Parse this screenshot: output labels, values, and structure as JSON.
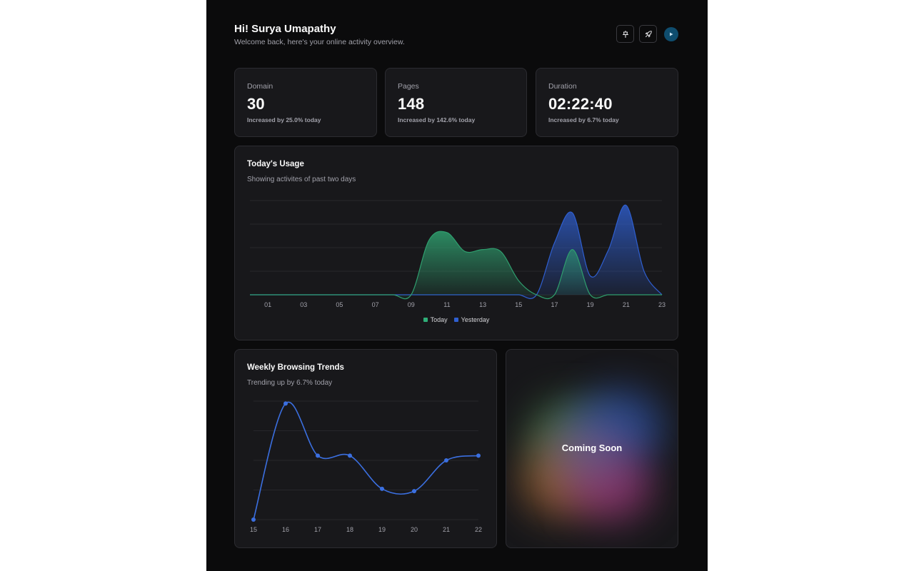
{
  "header": {
    "greeting": "Hi! Surya Umapathy",
    "subtitle": "Welcome back, here's your online activity overview."
  },
  "header_actions": [
    {
      "icon": "pin-icon"
    },
    {
      "icon": "rocket-icon"
    },
    {
      "icon": "avatar"
    }
  ],
  "stats": [
    {
      "label": "Domain",
      "value": "30",
      "note": "Increased by 25.0% today"
    },
    {
      "label": "Pages",
      "value": "148",
      "note": "Increased by 142.6% today"
    },
    {
      "label": "Duration",
      "value": "02:22:40",
      "note": "Increased by 6.7% today"
    }
  ],
  "usage_card": {
    "title": "Today's Usage",
    "subtitle": "Showing activites of past two days"
  },
  "weekly_card": {
    "title": "Weekly Browsing Trends",
    "subtitle": "Trending up by 6.7% today"
  },
  "coming_soon": {
    "text": "Coming Soon"
  },
  "colors": {
    "today": "#2f9e6e",
    "yesterday": "#2f5fd0",
    "line": "#3b6fe0"
  },
  "chart_data": [
    {
      "type": "area",
      "x": [
        "00",
        "01",
        "02",
        "03",
        "04",
        "05",
        "06",
        "07",
        "08",
        "09",
        "10",
        "11",
        "12",
        "13",
        "14",
        "15",
        "16",
        "17",
        "18",
        "19",
        "20",
        "21",
        "22",
        "23"
      ],
      "tick_labels": [
        "01",
        "03",
        "05",
        "07",
        "09",
        "11",
        "13",
        "15",
        "17",
        "19",
        "21",
        "23"
      ],
      "series": [
        {
          "name": "Today",
          "values": [
            0,
            0,
            0,
            0,
            0,
            0,
            0,
            0,
            0,
            0,
            0.58,
            0.66,
            0.46,
            0.48,
            0.46,
            0.15,
            0,
            0,
            0.48,
            0,
            0,
            0,
            0,
            0
          ]
        },
        {
          "name": "Yesterday",
          "values": [
            0,
            0,
            0,
            0,
            0,
            0,
            0,
            0,
            0,
            0,
            0,
            0,
            0,
            0,
            0,
            0,
            0,
            0.55,
            0.87,
            0.2,
            0.47,
            0.95,
            0.25,
            0
          ]
        }
      ],
      "grid": true,
      "legend": "bottom"
    },
    {
      "type": "line",
      "categories": [
        "15",
        "16",
        "17",
        "18",
        "19",
        "20",
        "21",
        "22"
      ],
      "values": [
        0,
        0.98,
        0.54,
        0.54,
        0.26,
        0.24,
        0.5,
        0.54
      ],
      "grid": true
    }
  ]
}
